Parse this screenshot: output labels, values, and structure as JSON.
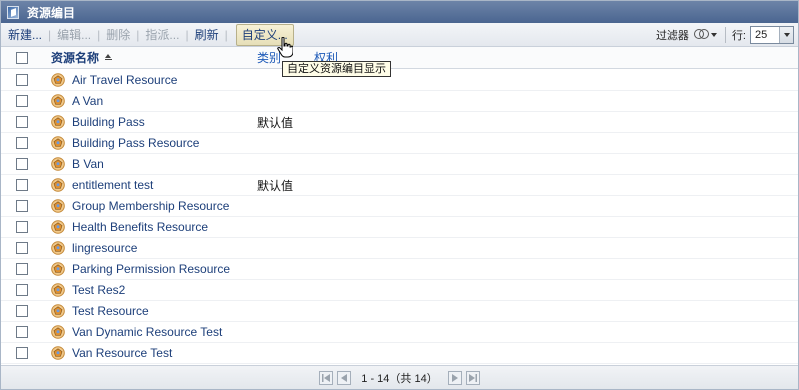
{
  "window": {
    "title": "资源编目"
  },
  "toolbar": {
    "new_label": "新建...",
    "edit_label": "编辑...",
    "delete_label": "删除",
    "assign_label": "指派...",
    "refresh_label": "刷新",
    "customize_label": "自定义...",
    "filter_label": "过滤器",
    "rows_label": "行:",
    "rows_value": "25"
  },
  "tooltip": {
    "text": "自定义资源编目显示"
  },
  "table": {
    "columns": {
      "name": "资源名称",
      "type": "类别",
      "extra": "权利"
    },
    "rows": [
      {
        "name": "Air Travel Resource",
        "type": ""
      },
      {
        "name": "A Van",
        "type": ""
      },
      {
        "name": "Building Pass",
        "type": "默认值"
      },
      {
        "name": "Building Pass Resource",
        "type": ""
      },
      {
        "name": "B Van",
        "type": ""
      },
      {
        "name": "entitlement test",
        "type": "默认值"
      },
      {
        "name": "Group Membership Resource",
        "type": ""
      },
      {
        "name": "Health Benefits Resource",
        "type": ""
      },
      {
        "name": "lingresource",
        "type": ""
      },
      {
        "name": "Parking Permission Resource",
        "type": ""
      },
      {
        "name": "Test Res2",
        "type": ""
      },
      {
        "name": "Test Resource",
        "type": ""
      },
      {
        "name": "Van Dynamic Resource Test",
        "type": ""
      },
      {
        "name": "Van Resource Test",
        "type": ""
      }
    ]
  },
  "pagination": {
    "text": "1 - 14（共 14）"
  },
  "colors": {
    "titlebar": "#4a6590",
    "link": "#1d3f7a",
    "header_link": "#1d5ab8"
  }
}
